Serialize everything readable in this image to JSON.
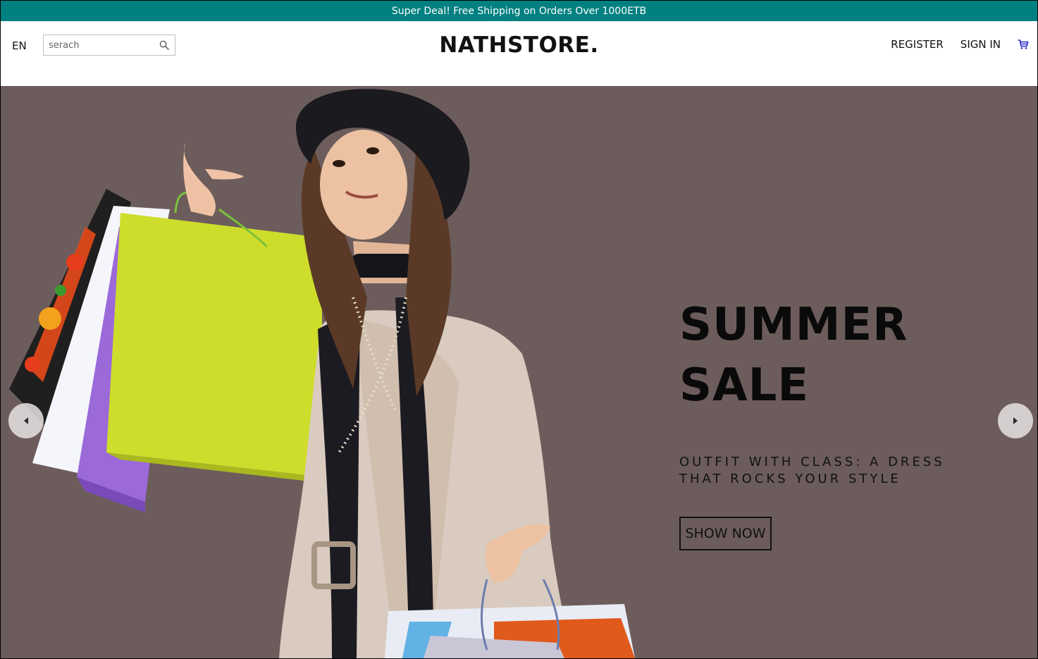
{
  "announcement": {
    "text": "Super Deal! Free Shipping on Orders Over 1000ETB"
  },
  "header": {
    "language": "EN",
    "search": {
      "placeholder": "serach",
      "icon": "search-icon"
    },
    "logo": "NATHSTORE.",
    "links": {
      "register": "REGISTER",
      "sign_in": "SIGN IN"
    },
    "cart_icon": "cart-icon"
  },
  "slider": {
    "background_color": "#6c5d5c",
    "title_line1": "SUMMER",
    "title_line2": "SALE",
    "description": "OUTFIT WITH CLASS: A DRESS THAT ROCKS YOUR STYLE",
    "cta_label": "SHOW NOW",
    "left_arrow_icon": "arrow-left-icon",
    "right_arrow_icon": "arrow-right-icon"
  },
  "colors": {
    "announcement_bg": "#008080",
    "cart_icon": "#1e24c8"
  }
}
